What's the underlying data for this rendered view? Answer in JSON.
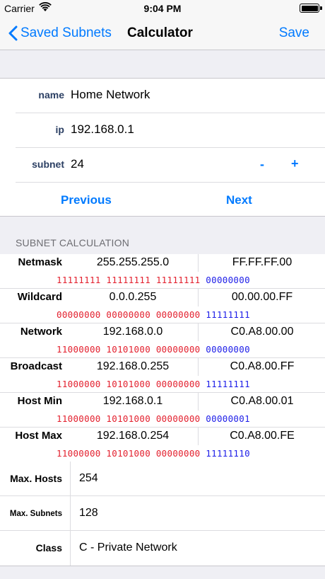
{
  "status": {
    "carrier": "Carrier",
    "time": "9:04 PM"
  },
  "nav": {
    "back": "Saved Subnets",
    "title": "Calculator",
    "save": "Save"
  },
  "form": {
    "name_label": "name",
    "name_value": "Home Network",
    "ip_label": "ip",
    "ip_value": "192.168.0.1",
    "subnet_label": "subnet",
    "subnet_value": "24",
    "minus": "-",
    "plus": "+",
    "previous": "Previous",
    "next": "Next"
  },
  "section_title": "SUBNET CALCULATION",
  "rows": [
    {
      "name": "Netmask",
      "dec": "255.255.255.0",
      "hex": "FF.FF.FF.00",
      "net_bits": "11111111 11111111 11111111",
      "host_bits": "00000000"
    },
    {
      "name": "Wildcard",
      "dec": "0.0.0.255",
      "hex": "00.00.00.FF",
      "net_bits": "00000000 00000000 00000000",
      "host_bits": "11111111"
    },
    {
      "name": "Network",
      "dec": "192.168.0.0",
      "hex": "C0.A8.00.00",
      "net_bits": "11000000 10101000 00000000",
      "host_bits": "00000000"
    },
    {
      "name": "Broadcast",
      "dec": "192.168.0.255",
      "hex": "C0.A8.00.FF",
      "net_bits": "11000000 10101000 00000000",
      "host_bits": "11111111"
    },
    {
      "name": "Host Min",
      "dec": "192.168.0.1",
      "hex": "C0.A8.00.01",
      "net_bits": "11000000 10101000 00000000",
      "host_bits": "00000001"
    },
    {
      "name": "Host Max",
      "dec": "192.168.0.254",
      "hex": "C0.A8.00.FE",
      "net_bits": "11000000 10101000 00000000",
      "host_bits": "11111110"
    }
  ],
  "info": {
    "max_hosts_label": "Max. Hosts",
    "max_hosts": "254",
    "max_subnets_label": "Max. Subnets",
    "max_subnets": "128",
    "class_label": "Class",
    "class_value": "C - Private Network"
  },
  "colors": {
    "accent": "#007aff",
    "network_bits": "#e3202e",
    "host_bits": "#1d1de8",
    "field_label": "#2b3f63"
  }
}
